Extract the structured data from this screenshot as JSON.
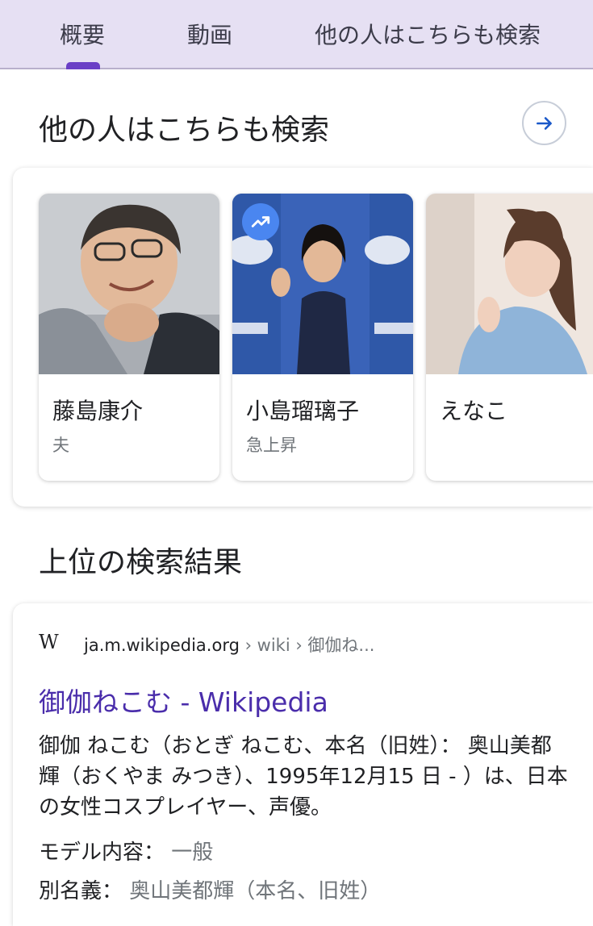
{
  "tabs": [
    {
      "label": "概要",
      "active": true
    },
    {
      "label": "動画",
      "active": false
    },
    {
      "label": "他の人はこちらも検索",
      "active": false
    }
  ],
  "people_also_search": {
    "title": "他の人はこちらも検索",
    "arrow_icon": "arrow-right-icon",
    "cards": [
      {
        "name": "藤島康介",
        "subtitle": "夫",
        "badge": null
      },
      {
        "name": "小島瑠璃子",
        "subtitle": "急上昇",
        "badge": "trending-up-icon"
      },
      {
        "name": "えなこ",
        "subtitle": "",
        "badge": null
      }
    ]
  },
  "top_results": {
    "title": "上位の検索結果"
  },
  "result": {
    "site_icon": "wikipedia-logo",
    "site_logo_text": "W",
    "domain": "ja.m.wikipedia.org",
    "breadcrumb": " › wiki › 御伽ね...",
    "link_title": "御伽ねこむ - Wikipedia",
    "snippet": "御伽 ねこむ（おとぎ ねこむ、本名（旧姓）： 奥山美都輝（おくやま みつき）、1995年12月15 日 - ）は、日本の女性コスプレイヤー、声優。",
    "facts": [
      {
        "label": "モデル内容：",
        "value": "一般"
      },
      {
        "label": "別名義：",
        "value": "奥山美都輝（本名、旧姓）"
      }
    ]
  },
  "colors": {
    "tabbar_bg": "#e6e0f3",
    "tab_indicator": "#6a3fc6",
    "link": "#4a2dab",
    "trend_badge": "#4a86f0",
    "arrow": "#1a58c9"
  }
}
